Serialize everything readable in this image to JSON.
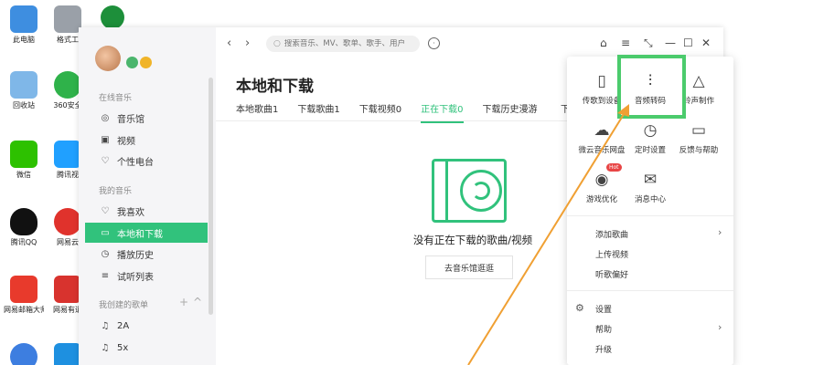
{
  "desktop": {
    "icons": [
      {
        "label": "此电脑",
        "color": "#3e8ee0"
      },
      {
        "label": "格式工",
        "color": "#9aa0a8"
      },
      {
        "label": "",
        "color": "#1d8f3a"
      },
      {
        "label": "回收站",
        "color": "#7fb7e8"
      },
      {
        "label": "360安全",
        "color": "#2fb24a"
      },
      {
        "label": "微信",
        "color": "#2dc100"
      },
      {
        "label": "腾讯视",
        "color": "#20a0ff"
      },
      {
        "label": "腾讯QQ",
        "color": "#111111"
      },
      {
        "label": "网易云",
        "color": "#e0322c"
      },
      {
        "label": "网易邮箱大师",
        "color": "#e83a2c"
      },
      {
        "label": "网易有道",
        "color": "#d8332e"
      },
      {
        "label": "",
        "color": "#3d7ee0"
      },
      {
        "label": "",
        "color": "#1e90e0"
      }
    ]
  },
  "sidebar": {
    "section_online": "在线音乐",
    "online_items": [
      {
        "icon": "music-hall-icon",
        "label": "音乐馆"
      },
      {
        "icon": "video-icon",
        "label": "视频"
      },
      {
        "icon": "radio-icon",
        "label": "个性电台"
      }
    ],
    "section_mine": "我的音乐",
    "mine_items": [
      {
        "icon": "heart-icon",
        "label": "我喜欢"
      },
      {
        "icon": "monitor-icon",
        "label": "本地和下载"
      },
      {
        "icon": "history-icon",
        "label": "播放历史"
      },
      {
        "icon": "list-icon",
        "label": "试听列表"
      }
    ],
    "section_created": "我创建的歌单",
    "playlists": [
      {
        "icon": "note-icon",
        "label": "2A"
      },
      {
        "icon": "note-icon",
        "label": "5x"
      }
    ]
  },
  "topbar": {
    "search_placeholder": "搜索音乐、MV、歌单、歌手、用户"
  },
  "main": {
    "title": "本地和下载",
    "tabs": [
      "本地歌曲1",
      "下载歌曲1",
      "下载视频0",
      "正在下载0",
      "下载历史漫游"
    ],
    "active_tab": "正在下载0",
    "tab_truncated": "下",
    "empty_text": "没有正在下载的歌曲/视频",
    "empty_button": "去音乐馆逛逛"
  },
  "panel": {
    "grid": [
      {
        "icon": "phone-icon",
        "label": "传歌到设备"
      },
      {
        "icon": "audio-wave-icon",
        "label": "音频转码"
      },
      {
        "icon": "bell-icon",
        "label": "铃声制作"
      },
      {
        "icon": "cloud-icon",
        "label": "微云音乐网盘"
      },
      {
        "icon": "clock-icon",
        "label": "定时设置"
      },
      {
        "icon": "feedback-icon",
        "label": "反馈与帮助"
      },
      {
        "icon": "gamepad-icon",
        "label": "游戏优化"
      },
      {
        "icon": "mail-icon",
        "label": "消息中心"
      }
    ],
    "hot_badge": "Hot",
    "menu1": [
      "添加歌曲",
      "上传视频",
      "听歌偏好"
    ],
    "menu2": [
      "设置",
      "帮助",
      "升级"
    ]
  },
  "colors": {
    "accent": "#31c27c",
    "highlight": "#4bcb6c",
    "arrow": "#f0a033"
  }
}
